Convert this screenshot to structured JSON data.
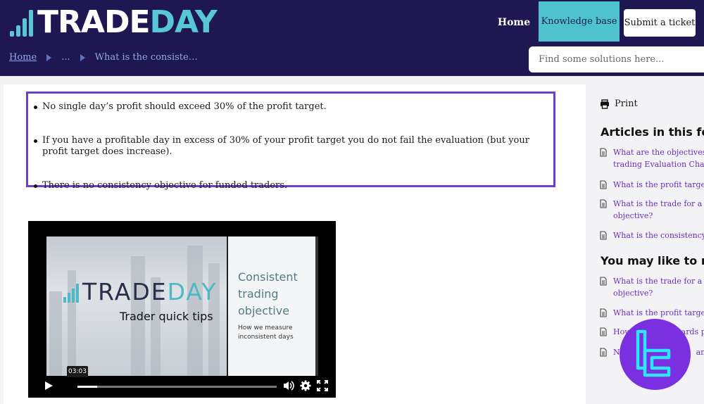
{
  "brand": {
    "logo_white": "TRADE",
    "logo_accent": "DAY",
    "accent_color": "#57c7d5",
    "header_bg": "#1f1752"
  },
  "nav": {
    "home": "Home",
    "knowledge_base": "Knowledge base",
    "submit_ticket": "Submit a ticket"
  },
  "breadcrumb": {
    "home": "Home",
    "ellipsis": "...",
    "current": "What is the consiste…"
  },
  "search": {
    "placeholder": "Find some solutions here..."
  },
  "article": {
    "bullets": [
      "No single day’s profit should exceed 30% of the profit target.",
      "If you have a profitable day in excess of 30% of your profit target you do not fail the evaluation (but your profit target does increase).",
      "There is no consistency objective for funded traders."
    ],
    "highlight_color": "#6a3fce"
  },
  "video": {
    "logo_white": "TRADE",
    "logo_accent": "DAY",
    "subtitle": "Trader quick tips",
    "slide_title": "Consistent trading objective",
    "slide_caption": "How we measure inconsistent days",
    "timestamp": "03:03",
    "progress": 0.1,
    "icons": [
      "play-icon",
      "volume-icon",
      "settings-icon",
      "fullscreen-icon"
    ]
  },
  "sidebar": {
    "print_label": "Print",
    "folder_heading": "Articles in this fold",
    "folder_articles": [
      {
        "line1": "What are the objectives and",
        "line2": "trading Evaluation Challen"
      },
      {
        "line1": "What is the profit target ob",
        "line2": ""
      },
      {
        "line1": "What is the trade for a mini",
        "line2": "objective?"
      },
      {
        "line1": "What is the consistency obj",
        "line2": ""
      }
    ],
    "like_heading": "You may like to rea",
    "like_articles": [
      {
        "line1": "What is the trade for a mini",
        "line2": "objective?"
      },
      {
        "line1": "What is the profit target ob",
        "line2": ""
      },
      {
        "line1": "How",
        "tail": "ards po",
        "line2": ""
      },
      {
        "line1": "N",
        "tail": "answ",
        "line2": ""
      }
    ]
  }
}
